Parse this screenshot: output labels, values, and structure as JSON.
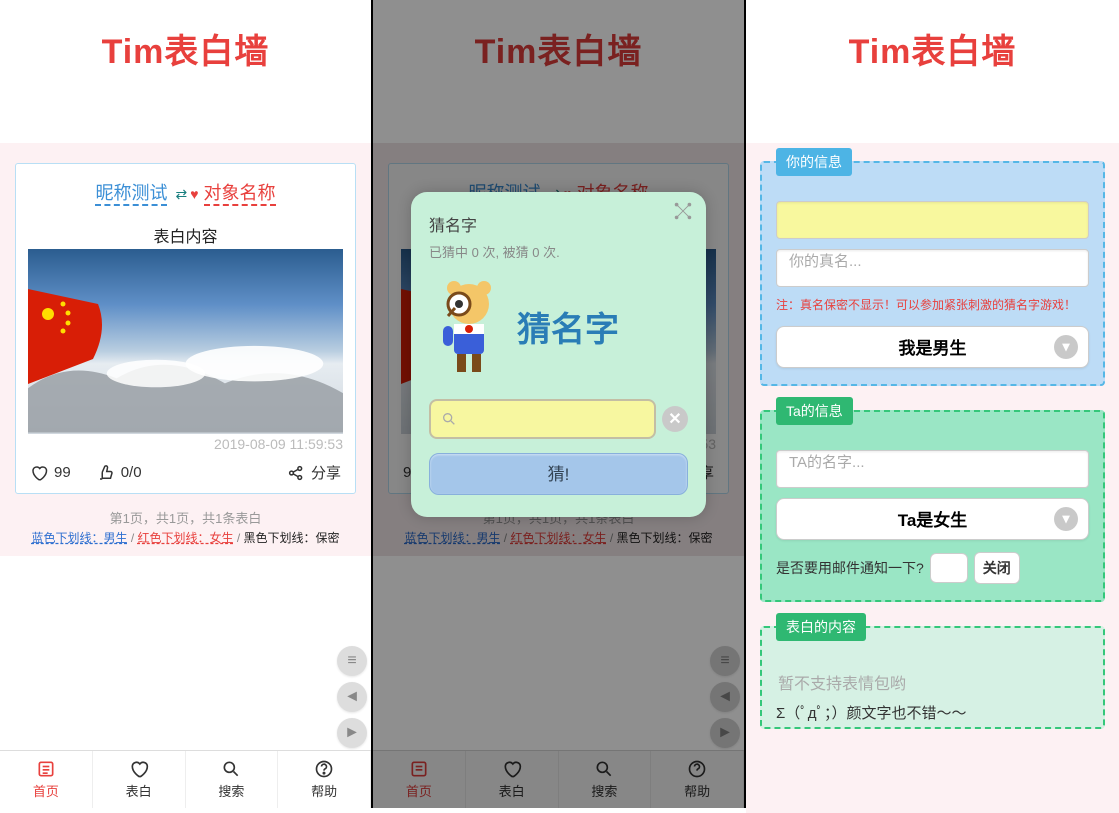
{
  "header": {
    "title": "Tim表白墙"
  },
  "card": {
    "from": "昵称测试",
    "to": "对象名称",
    "content_label": "表白内容",
    "timestamp": "2019-08-09 11:59:53",
    "likes": "99",
    "ratio": "0/0",
    "share": "分享"
  },
  "pager": "第1页，共1页，共1条表白",
  "legend": {
    "blue": "蓝色下划线：男生",
    "red": "红色下划线：女生",
    "black": "黑色下划线：保密"
  },
  "tabs": {
    "home": "首页",
    "confess": "表白",
    "search": "搜索",
    "help": "帮助"
  },
  "popup": {
    "title": "猜名字",
    "sub": "已猜中 0 次, 被猜 0 次.",
    "illus_text": "猜名字",
    "button": "猜!"
  },
  "form": {
    "section1_title": "你的信息",
    "realname_placeholder": "你的真名...",
    "note": "注：真名保密不显示！可以参加紧张刺激的猜名字游戏！",
    "gender1": "我是男生",
    "section2_title": "Ta的信息",
    "ta_name_placeholder": "TA的名字...",
    "gender2": "Ta是女生",
    "mail_label": "是否要用邮件通知一下?",
    "mail_off": "关闭",
    "section3_title": "表白的内容",
    "content_placeholder": "暂不支持表情包哟",
    "kaomoji": "Σ（ﾟдﾟ；）颜文字也不错～～"
  }
}
